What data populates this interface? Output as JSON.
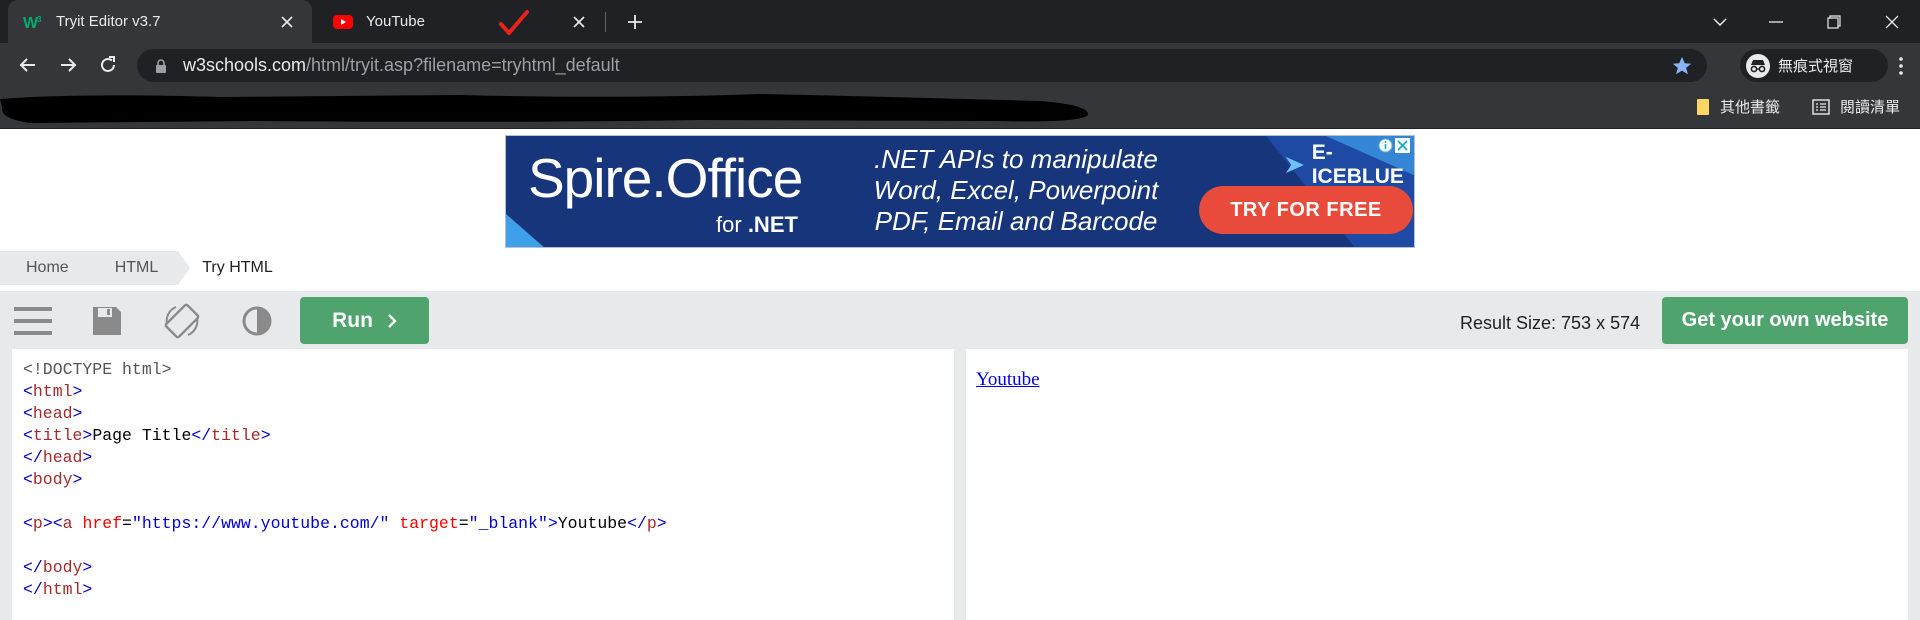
{
  "browser": {
    "tabs": [
      {
        "title": "Tryit Editor v3.7",
        "favicon": "w3schools-favicon",
        "active": true
      },
      {
        "title": "YouTube",
        "favicon": "youtube-favicon",
        "active": false
      }
    ],
    "address": {
      "host": "w3schools.com",
      "path": "/html/tryit.asp?filename=tryhtml_default"
    },
    "profile_label": "無痕式視窗",
    "bookmarks": {
      "other_label": "其他書籤",
      "reading_list_label": "閱讀清單"
    }
  },
  "ad": {
    "title": "Spire.Office",
    "subtitle_for": "for",
    "subtitle_net": ".NET",
    "copy_lines": [
      ".NET APIs to manipulate",
      "Word, Excel, Powerpoint",
      "PDF, Email and Barcode"
    ],
    "cta": "TRY FOR FREE",
    "brand": "E-ICEBLUE"
  },
  "breadcrumb": [
    "Home",
    "HTML",
    "Try HTML"
  ],
  "editor": {
    "run_label": "Run",
    "result_size": "Result Size: 753 x 574",
    "get_website_label": "Get your own website"
  },
  "code": {
    "doctype": "<!DOCTYPE html>",
    "html_open": "html",
    "head_open": "head",
    "title_open": "title",
    "title_text": "Page Title",
    "title_close": "title",
    "head_close": "head",
    "body_open": "body",
    "p_open": "p",
    "a_tag": "a",
    "href_attr": "href",
    "href_value": "\"https://www.youtube.com/\"",
    "target_attr": "target",
    "target_value": "\"_blank\"",
    "link_text": "Youtube",
    "p_close": "p",
    "body_close": "body",
    "html_close": "html"
  },
  "result": {
    "link_text": "Youtube"
  },
  "colors": {
    "accent_green": "#4fa36c",
    "chrome_dark": "#202124",
    "chrome_mid": "#35363a",
    "ad_blue": "#17357a",
    "ad_cta": "#e84b3c"
  }
}
